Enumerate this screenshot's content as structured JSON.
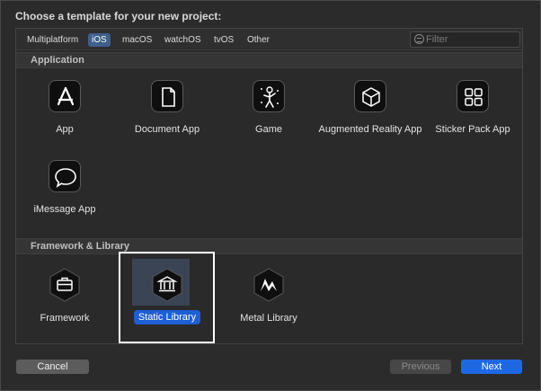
{
  "prompt": "Choose a template for your new project:",
  "tabs": [
    {
      "label": "Multiplatform"
    },
    {
      "label": "iOS",
      "selected": true
    },
    {
      "label": "macOS"
    },
    {
      "label": "watchOS"
    },
    {
      "label": "tvOS"
    },
    {
      "label": "Other"
    }
  ],
  "filter": {
    "placeholder": "Filter"
  },
  "sections": {
    "application": {
      "title": "Application",
      "items": [
        {
          "label": "App",
          "icon": "app-store-icon"
        },
        {
          "label": "Document App",
          "icon": "document-icon"
        },
        {
          "label": "Game",
          "icon": "game-icon"
        },
        {
          "label": "Augmented Reality App",
          "icon": "ar-cube-icon"
        },
        {
          "label": "Sticker Pack App",
          "icon": "sticker-grid-icon"
        },
        {
          "label": "iMessage App",
          "icon": "message-bubble-icon"
        }
      ]
    },
    "framework": {
      "title": "Framework & Library",
      "items": [
        {
          "label": "Framework",
          "icon": "toolbox-icon"
        },
        {
          "label": "Static Library",
          "icon": "library-building-icon",
          "selected": true
        },
        {
          "label": "Metal Library",
          "icon": "metal-icon"
        }
      ]
    }
  },
  "buttons": {
    "cancel": "Cancel",
    "previous": "Previous",
    "next": "Next"
  },
  "colors": {
    "accent": "#1e69e3",
    "selected_tab": "#3f5f8c"
  }
}
